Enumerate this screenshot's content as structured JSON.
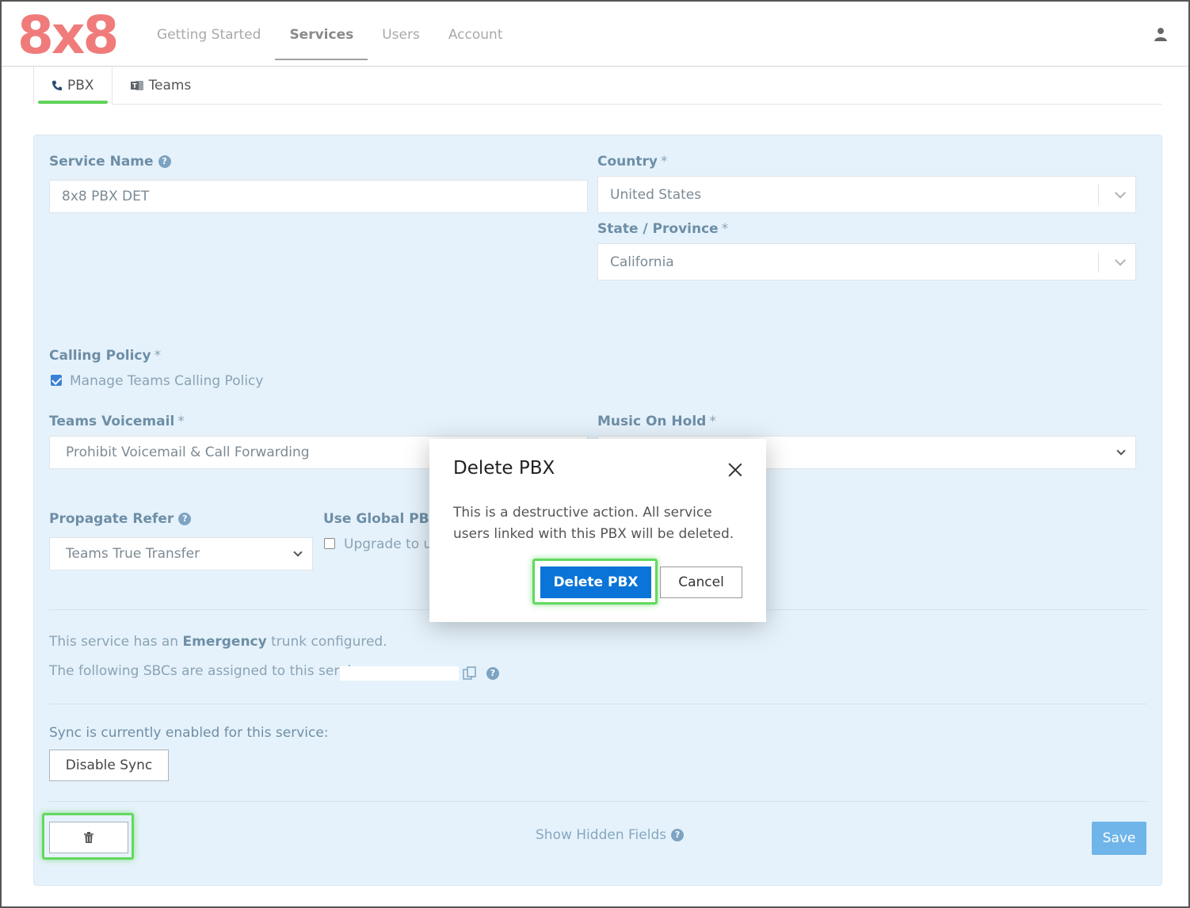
{
  "header": {
    "logo": "8x8",
    "nav": [
      "Getting Started",
      "Services",
      "Users",
      "Account"
    ],
    "active_nav": "Services",
    "user_icon": "user-icon"
  },
  "tabs": [
    {
      "label": "PBX",
      "icon": "phone-icon"
    },
    {
      "label": "Teams",
      "icon": "teams-icon"
    }
  ],
  "form": {
    "service_name": {
      "label": "Service Name",
      "value": "8x8 PBX DET"
    },
    "country": {
      "label": "Country",
      "req": "*",
      "value": "United States"
    },
    "state": {
      "label": "State / Province",
      "req": "*",
      "value": "California"
    },
    "calling_policy": {
      "label": "Calling Policy",
      "req": "*",
      "checkbox_label": "Manage Teams Calling Policy",
      "checked": true
    },
    "teams_voicemail": {
      "label": "Teams Voicemail",
      "req": "*",
      "value": "Prohibit Voicemail & Call Forwarding"
    },
    "music_on_hold": {
      "label": "Music On Hold",
      "req": "*",
      "value": ""
    },
    "propagate_refer": {
      "label": "Propagate Refer",
      "value": "Teams True Transfer"
    },
    "use_global_pbx": {
      "label": "Use Global PBX",
      "checkbox_label": "Upgrade to us",
      "checked": false
    },
    "emergency": {
      "prefix": "This service has an ",
      "bold": "Emergency",
      "suffix": " trunk configured."
    },
    "sbc_text": "The following SBCs are assigned to this service:",
    "sync_text": "Sync is currently enabled for this service:",
    "disable_sync": "Disable Sync",
    "show_hidden": "Show Hidden Fields",
    "save": "Save"
  },
  "modal": {
    "title": "Delete PBX",
    "body": "This is a destructive action. All service users linked with this PBX will be deleted.",
    "confirm": "Delete PBX",
    "cancel": "Cancel"
  },
  "colors": {
    "logo": "#f07b7b",
    "panel_bg": "#e6f2fb",
    "primary": "#0a74d8",
    "save": "#6fb5e9",
    "highlight": "#62d95e"
  }
}
